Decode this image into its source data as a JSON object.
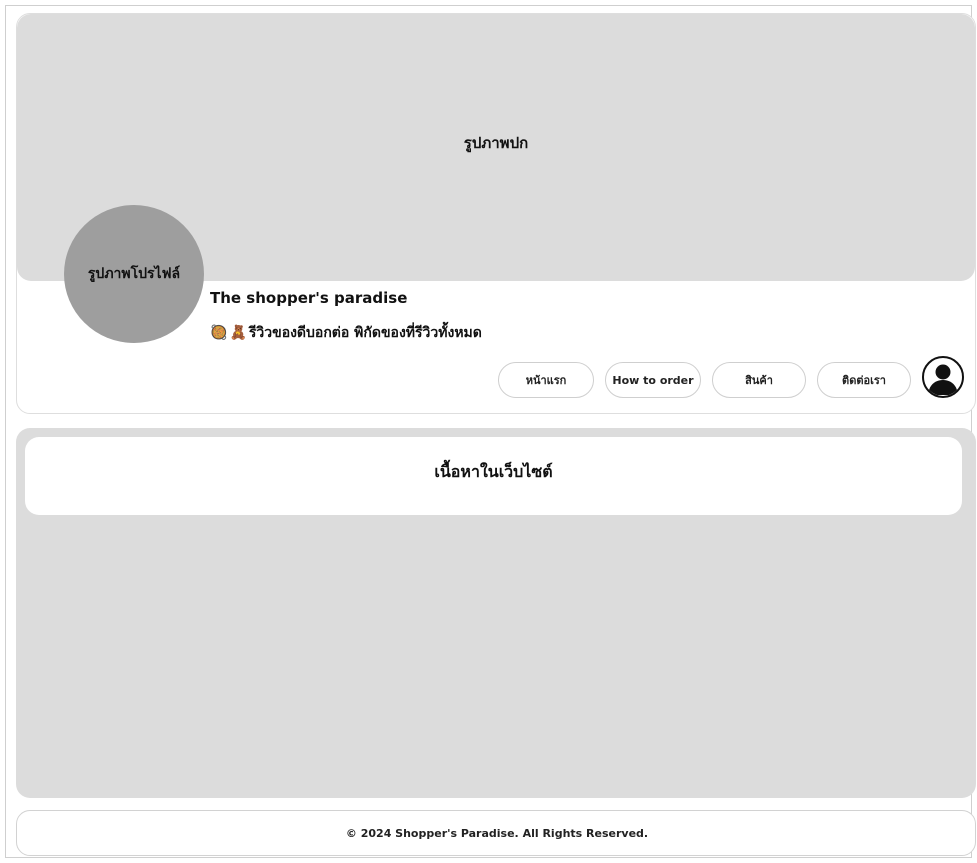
{
  "cover": {
    "label": "รูปภาพปก"
  },
  "profile": {
    "avatar_label": "รูปภาพโปรไฟล์",
    "name": "The shopper's paradise",
    "tagline_emoji_1": "🥘",
    "tagline_emoji_2": "🧸",
    "tagline": "รีวิวของดีบอกต่อ พิกัดของที่รีวิวทั้งหมด"
  },
  "nav": {
    "items": [
      {
        "label": "หน้าแรก"
      },
      {
        "label": "How to order"
      },
      {
        "label": "สินค้า"
      },
      {
        "label": "ติดต่อเรา"
      }
    ],
    "user_icon": "user-account-icon"
  },
  "content": {
    "label": "เนื้อหาในเว็บไซต์"
  },
  "footer": {
    "text": "© 2024 Shopper's Paradise. All Rights Reserved."
  },
  "colors": {
    "cover_bg": "#dcdcdc",
    "avatar_bg": "#9e9e9e",
    "content_bg": "#dcdcdc",
    "card_bg": "#ffffff",
    "border": "#cfcfcf"
  }
}
